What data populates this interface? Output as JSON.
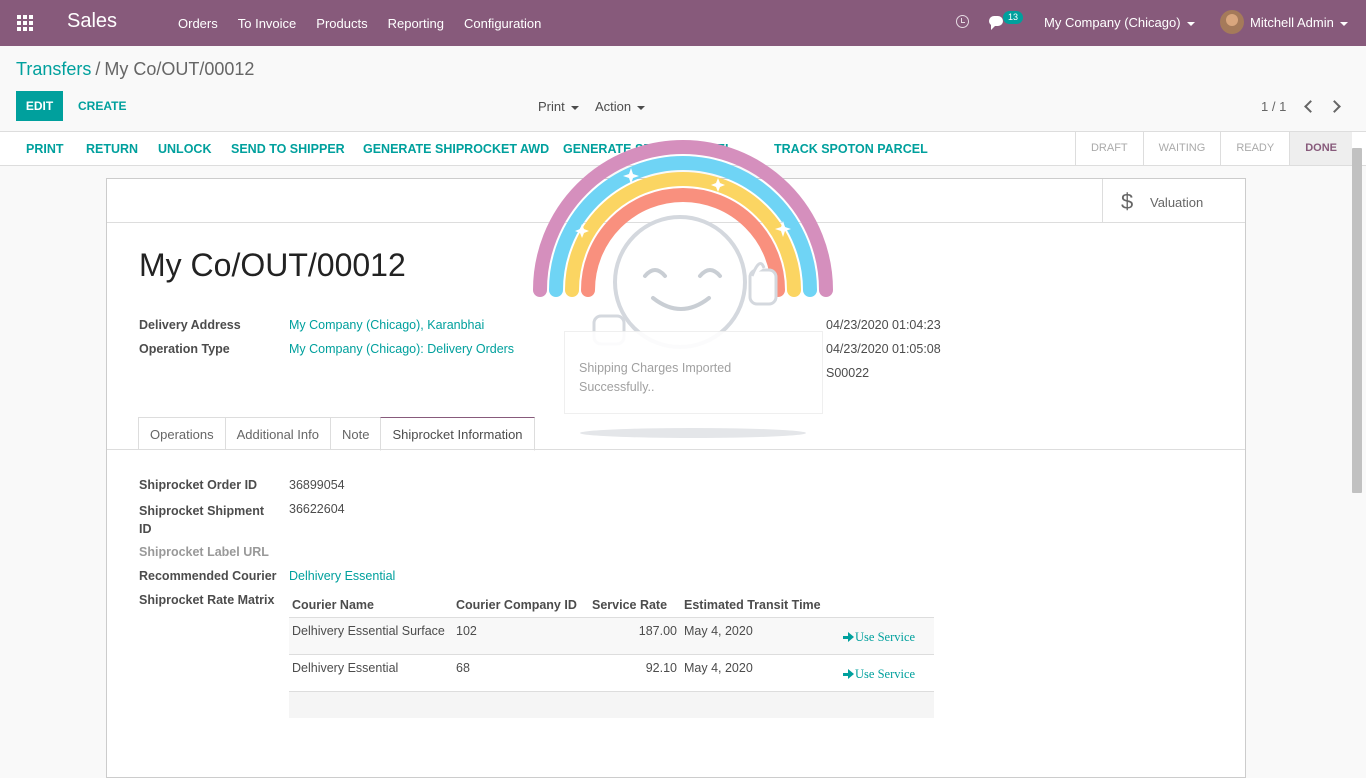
{
  "navbar": {
    "app_name": "Sales",
    "menu": [
      "Orders",
      "To Invoice",
      "Products",
      "Reporting",
      "Configuration"
    ],
    "message_count": "13",
    "company": "My Company (Chicago)",
    "user": "Mitchell Admin"
  },
  "breadcrumb": {
    "parent": "Transfers",
    "current": "My Co/OUT/00012"
  },
  "controls": {
    "edit": "EDIT",
    "create": "CREATE",
    "print": "Print",
    "action": "Action",
    "pager": "1 / 1"
  },
  "header_buttons": [
    "PRINT",
    "RETURN",
    "UNLOCK",
    "SEND TO SHIPPER",
    "GENERATE SHIPROCKET AWD",
    "GENERATE SPOTON LABEL",
    "TRACK SPOTON PARCEL"
  ],
  "stages": {
    "items": [
      "DRAFT",
      "WAITING",
      "READY",
      "DONE"
    ],
    "active": "DONE"
  },
  "smart_button": {
    "label": "Valuation",
    "icon": "dollar-icon"
  },
  "record": {
    "name": "My Co/OUT/00012",
    "delivery_address_label": "Delivery Address",
    "delivery_address": "My Company (Chicago), Karanbhai",
    "operation_type_label": "Operation Type",
    "operation_type": "My Company (Chicago): Delivery Orders",
    "right_values": [
      "04/23/2020 01:04:23",
      "04/23/2020 01:05:08",
      "S00022"
    ]
  },
  "tabs": {
    "items": [
      "Operations",
      "Additional Info",
      "Note",
      "Shiprocket Information"
    ],
    "active": "Shiprocket Information"
  },
  "shiprocket": {
    "order_id_label": "Shiprocket Order ID",
    "order_id": "36899054",
    "shipment_id_label": "Shiprocket Shipment ID",
    "shipment_id": "36622604",
    "label_url_label": "Shiprocket Label URL",
    "courier_label": "Recommended Courier",
    "courier": "Delhivery Essential",
    "matrix_label": "Shiprocket Rate Matrix",
    "matrix_headers": [
      "Courier Name",
      "Courier Company ID",
      "Service Rate",
      "Estimated Transit Time"
    ],
    "matrix_rows": [
      {
        "name": "Delhivery Essential Surface",
        "company_id": "102",
        "rate": "187.00",
        "transit": "May 4, 2020",
        "action": "Use Service"
      },
      {
        "name": "Delhivery Essential",
        "company_id": "68",
        "rate": "92.10",
        "transit": "May 4, 2020",
        "action": "Use Service"
      }
    ]
  },
  "notification": {
    "text": "Shipping Charges Imported Successfully.."
  },
  "colors": {
    "primary": "#875a7b",
    "accent": "#00a09d"
  }
}
